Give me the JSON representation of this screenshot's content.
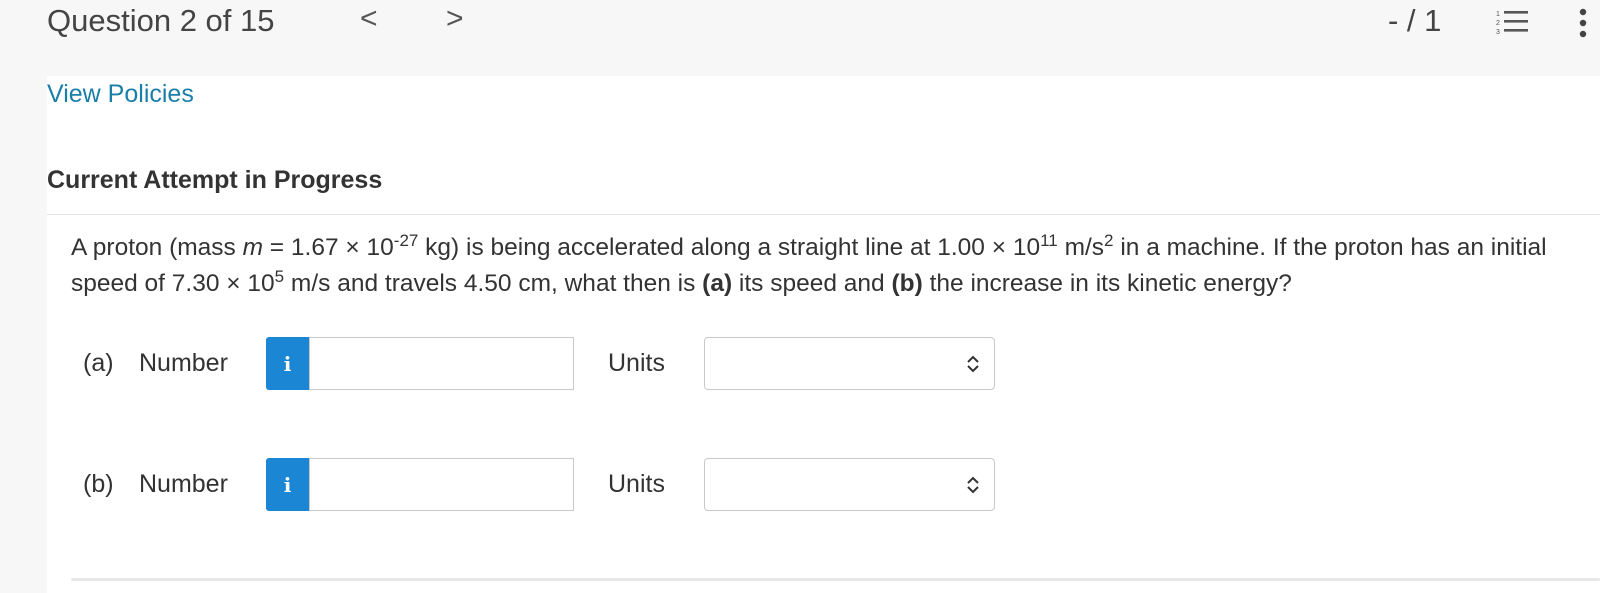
{
  "header": {
    "question_label": "Question 2 of 15",
    "prev_glyph": "<",
    "next_glyph": ">",
    "score": "- / 1",
    "list_icon": "numbered-list-icon",
    "more_icon": "more-vertical-icon"
  },
  "links": {
    "view_policies": "View Policies"
  },
  "attempt_heading": "Current Attempt in Progress",
  "question": {
    "t1": "A proton (mass ",
    "m": "m",
    "t2": " = 1.67 × 10",
    "e1": "-27",
    "t3": " kg) is being accelerated along a straight line at 1.00 × 10",
    "e2": "11",
    "t4": " m/s",
    "e3": "2",
    "t5": " in a machine. If the proton has an initial speed of 7.30 × 10",
    "e4": "5",
    "t6": " m/s and travels 4.50 cm, what then is ",
    "a": "(a)",
    "t7": " its speed and ",
    "b": "(b)",
    "t8": " the increase in its kinetic energy?"
  },
  "parts": [
    {
      "label": "(a)",
      "number_label": "Number",
      "info_glyph": "i",
      "number_value": "",
      "units_label": "Units",
      "units_value": ""
    },
    {
      "label": "(b)",
      "number_label": "Number",
      "info_glyph": "i",
      "number_value": "",
      "units_label": "Units",
      "units_value": ""
    }
  ],
  "colors": {
    "link": "#1a7fa8",
    "info_button": "#1a86d4",
    "background": "#f7f7f7"
  }
}
